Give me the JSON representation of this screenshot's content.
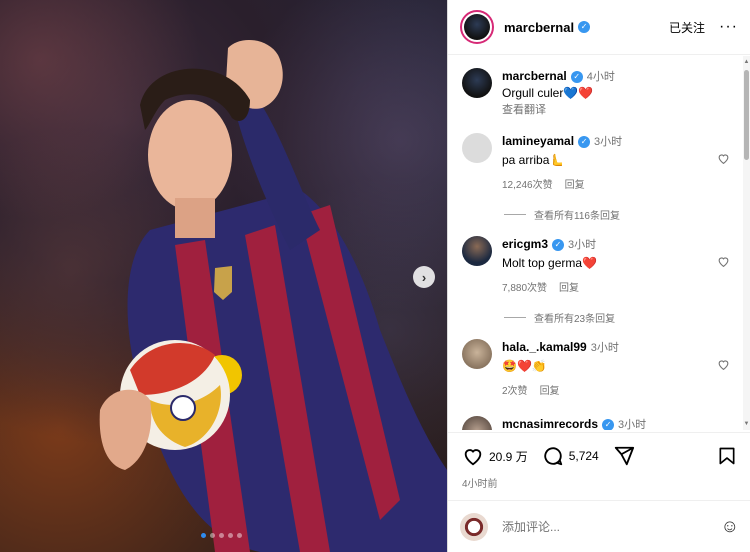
{
  "header": {
    "username": "marcbernal",
    "follow_label": "已关注",
    "more_label": "···"
  },
  "comments": [
    {
      "user": "marcbernal",
      "time": "4小时",
      "text": "Orgull culer💙❤️",
      "translate": "查看翻译"
    },
    {
      "user": "lamineyamal",
      "time": "3小时",
      "text": "pa arriba🫷",
      "likes": "12,246次赞",
      "reply": "回复",
      "view_replies": "查看所有116条回复"
    },
    {
      "user": "ericgm3",
      "time": "3小时",
      "text": "Molt top germa❤️",
      "likes": "7,880次赞",
      "reply": "回复",
      "view_replies": "查看所有23条回复"
    },
    {
      "user": "hala._.kamal99",
      "time": "3小时",
      "text": "🤩❤️👏",
      "likes": "2次赞",
      "reply": "回复"
    },
    {
      "user": "mcnasimrecords",
      "time": "3小时"
    }
  ],
  "actions": {
    "likes": "20.9 万",
    "comments": "5,724",
    "ago": "4小时前"
  },
  "add_comment": {
    "placeholder": "添加评论..."
  },
  "media": {
    "slides": 5,
    "active_slide": 1,
    "next_glyph": "›"
  }
}
